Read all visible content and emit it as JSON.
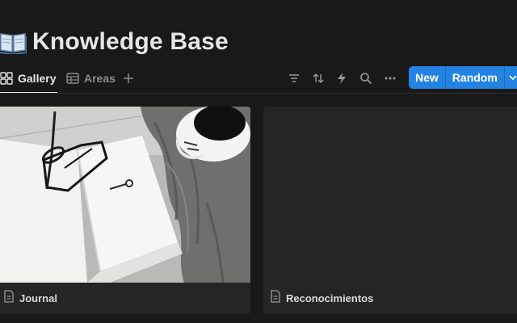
{
  "page": {
    "icon": "open-book-icon",
    "title": "Knowledge Base"
  },
  "views": [
    {
      "label": "Gallery",
      "icon": "gallery-grid-icon",
      "active": true
    },
    {
      "label": "Areas",
      "icon": "table-icon",
      "active": false
    }
  ],
  "toolbar": {
    "add_view_icon": "plus-icon",
    "tools": [
      "filter-icon",
      "sort-icon",
      "lightning-icon",
      "search-icon",
      "more-icon"
    ],
    "new_label": "New",
    "random_label": "Random",
    "dropdown_icon": "chevron-down-icon",
    "accent": "#2383e2"
  },
  "cards": [
    {
      "title": "Journal",
      "icon": "document-icon",
      "has_cover": true
    },
    {
      "title": "Reconocimientos",
      "icon": "document-icon",
      "has_cover": false
    }
  ]
}
